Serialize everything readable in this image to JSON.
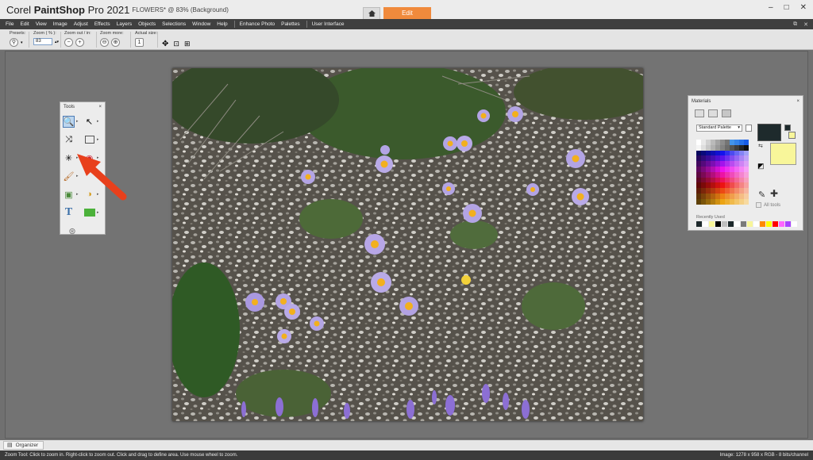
{
  "titlebar": {
    "app_name_prefix": "Corel",
    "app_name_main": "PaintShop",
    "app_name_suffix": "Pro 2021",
    "document": "FLOWERS* @  83% (Background)",
    "home_icon": "home-icon",
    "active_tab": "Edit"
  },
  "menu": {
    "items": [
      "File",
      "Edit",
      "View",
      "Image",
      "Adjust",
      "Effects",
      "Layers",
      "Objects",
      "Selections",
      "Window",
      "Help"
    ],
    "extra": [
      "Enhance Photo",
      "Palettes",
      "User Interface"
    ]
  },
  "options": {
    "presets_label": "Presets:",
    "zoom_label": "Zoom ( % ):",
    "zoom_value": "83",
    "zoom_inout_label": "Zoom out / in:",
    "zoom_more_label": "Zoom more:",
    "actual_size_label": "Actual size:"
  },
  "tools_panel": {
    "title": "Tools",
    "close": "×",
    "tools": [
      "zoom-tool",
      "pick-tool",
      "dropper-tool",
      "selection-tool",
      "makeover-tool",
      "red-eye-tool",
      "paint-brush-tool",
      "eraser-tool",
      "clone-tool",
      "flood-fill-tool",
      "text-tool",
      "rectangle-tool",
      "smart-carver-tool"
    ]
  },
  "materials_panel": {
    "title": "Materials",
    "close": "×",
    "palette_select": "Standard Palette",
    "all_tools_label": "All tools",
    "recent_label": "Recently Used",
    "foreground_color": "#1e2a2c",
    "background_color": "#f8f69a",
    "recent_colors": [
      "#1e2a2c",
      "#ffffff",
      "#f8f69a",
      "#000000",
      "#c0c0c0",
      "#1e2a2c",
      "#ffffff",
      "#7a7a7a",
      "#f8f69a",
      "#ffffff",
      "#ff8800",
      "#ffff00",
      "#ff0000",
      "#ff66ff",
      "#aa44ff",
      "#ffffff"
    ]
  },
  "organizer": {
    "label": "Organizer"
  },
  "status": {
    "left": "Zoom Tool: Click to zoom in. Right-click to zoom out. Click and drag to define area. Use mouse wheel to zoom.",
    "right": "Image:  1278 x 958 x RGB - 8 bits/channel"
  }
}
